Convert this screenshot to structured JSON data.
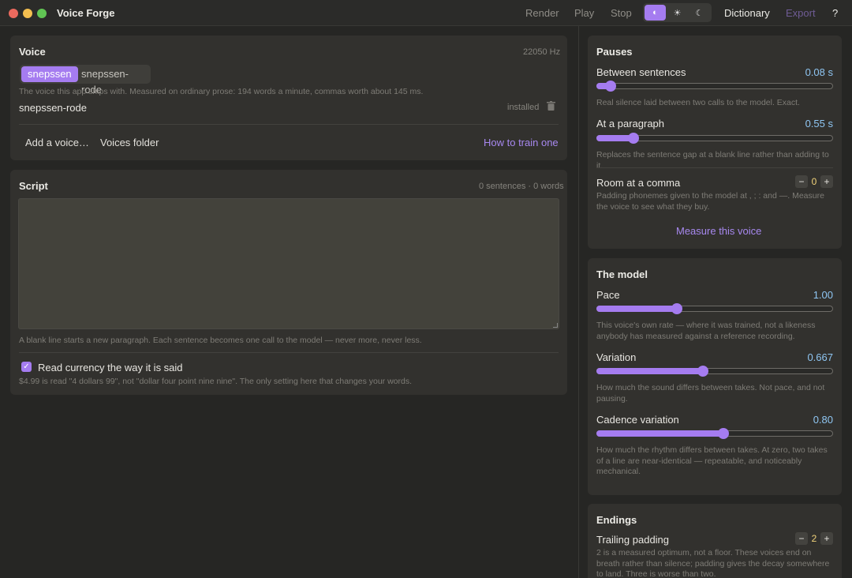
{
  "app": {
    "title": "Voice Forge"
  },
  "toolbar": {
    "render": "Render",
    "play": "Play",
    "stop": "Stop",
    "theme_auto_icon": "half-circle-icon",
    "theme_light_icon": "sun-icon",
    "theme_dark_icon": "moon-icon",
    "theme_auto": "◐",
    "theme_light": "☀",
    "theme_dark": "☾",
    "dictionary": "Dictionary",
    "export": "Export",
    "help": "?"
  },
  "voice": {
    "heading": "Voice",
    "sample_rate": "22050 Hz",
    "tabs": [
      {
        "label": "snepssen",
        "selected": true
      },
      {
        "label": "snepssen-rode",
        "selected": false
      }
    ],
    "description": "The voice this app ships with. Measured on ordinary prose: 194 words a minute, commas worth about 145 ms.",
    "installed_name": "snepssen-rode",
    "installed_status": "installed",
    "add_voice": "Add a voice…",
    "voices_folder": "Voices folder",
    "how_to_train": "How to train one"
  },
  "script": {
    "heading": "Script",
    "counts": "0 sentences · 0 words",
    "text": "",
    "hint": "A blank line starts a new paragraph. Each sentence becomes one call to the model — never more, never less.",
    "currency_label": "Read currency the way it is said",
    "currency_checked": true,
    "currency_note": "$4.99 is read \"4 dollars 99\", not \"dollar four point nine nine\". The only setting here that changes your words."
  },
  "pauses": {
    "heading": "Pauses",
    "between_sentences": {
      "label": "Between sentences",
      "value": "0.08 s",
      "fraction": 0.06,
      "note": "Real silence laid between two calls to the model. Exact."
    },
    "at_paragraph": {
      "label": "At a paragraph",
      "value": "0.55 s",
      "fraction": 0.155,
      "note": "Replaces the sentence gap at a blank line rather than adding to it."
    },
    "comma": {
      "label": "Room at a comma",
      "minus": "−",
      "value": "0",
      "plus": "+",
      "note": "Padding phonemes given to the model at , ; : and —. Measure the voice to see what they buy."
    },
    "measure": "Measure this voice"
  },
  "model": {
    "heading": "The model",
    "pace": {
      "label": "Pace",
      "value": "1.00",
      "fraction": 0.34,
      "note": "This voice's own rate — where it was trained, not a likeness anybody has measured against a reference recording."
    },
    "variation": {
      "label": "Variation",
      "value": "0.667",
      "fraction": 0.45,
      "note": "How much the sound differs between takes. Not pace, and not pausing."
    },
    "cadence": {
      "label": "Cadence variation",
      "value": "0.80",
      "fraction": 0.535,
      "note": "How much the rhythm differs between takes. At zero, two takes of a line are near-identical — repeatable, and noticeably mechanical."
    }
  },
  "endings": {
    "heading": "Endings",
    "trailing": {
      "label": "Trailing padding",
      "minus": "−",
      "value": "2",
      "plus": "+",
      "note": "2 is a measured optimum, not a floor. These voices end on breath rather than silence; padding gives the decay somewhere to land. Three is worse than two."
    }
  },
  "colors": {
    "accent": "#a57cf0",
    "value_blue": "#8fc6f3",
    "stepper_value": "#f1d37a"
  }
}
